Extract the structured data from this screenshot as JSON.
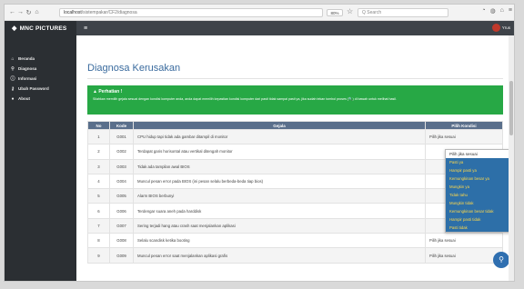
{
  "browser": {
    "url_host": "localhost",
    "url_path": "/sistempakar/CF2/diagnosa",
    "zoom": "80%",
    "search_placeholder": "Q Search"
  },
  "app": {
    "brand": "MNC PICTURES",
    "user_name": "Yrus"
  },
  "sidebar": {
    "items": [
      {
        "label": "Beranda",
        "icon": "home-icon"
      },
      {
        "label": "Diagnosa",
        "icon": "search-icon"
      },
      {
        "label": "Informasi",
        "icon": "info-icon"
      },
      {
        "label": "Ubah Password",
        "icon": "key-icon"
      },
      {
        "label": "About",
        "icon": "info-circle-icon"
      }
    ]
  },
  "page": {
    "title": "Diagnosa Kerusakan"
  },
  "alert": {
    "title": "Perhatian !",
    "text": "Silahkan memilih gejala sesuai dengan kondisi komputer anda, anda dapat memilih kepastian kondisi komputer dari pasti tidak sampai pasti ya, jika sudah tekan tombol proses (🔍) di bawah untuk melihat hasil."
  },
  "table": {
    "headers": [
      "No",
      "Kode",
      "Gejala",
      "Pilih Kondisi"
    ],
    "rows": [
      {
        "no": "1",
        "kode": "G001",
        "gejala": "CPU hidup tapi tidak ada gambar ditampil di monitor",
        "pilih": "Pilih jika sesuai"
      },
      {
        "no": "2",
        "kode": "G002",
        "gejala": "Terdapat garis horisontal atau vertikal ditengah monitor",
        "pilih": ""
      },
      {
        "no": "3",
        "kode": "G003",
        "gejala": "Tidak ada tampilan awal BIOS",
        "pilih": ""
      },
      {
        "no": "4",
        "kode": "G004",
        "gejala": "Muncul pesan error pada BIOS (ini pesan selalu berbeda-beda tiap bios)",
        "pilih": ""
      },
      {
        "no": "5",
        "kode": "G005",
        "gejala": "Alarm BIOS berbunyi",
        "pilih": ""
      },
      {
        "no": "6",
        "kode": "G006",
        "gejala": "Terdengar suara aneh pada harddisk",
        "pilih": ""
      },
      {
        "no": "7",
        "kode": "G007",
        "gejala": "Sering terjadi hang atau crash saat menjalankan aplikasi",
        "pilih": ""
      },
      {
        "no": "8",
        "kode": "G008",
        "gejala": "Selalu scandisk ketika booting",
        "pilih": "Pilih jika sesuai"
      },
      {
        "no": "9",
        "kode": "G009",
        "gejala": "Muncul pesan error saat menjalankan aplikasi grafis",
        "pilih": "Pilih jika sesuai"
      }
    ]
  },
  "dropdown": {
    "selected": "Pilih jika sesuai",
    "options": [
      "Pasti ya",
      "Hampir pasti ya",
      "Kemungkinan besar ya",
      "Mungkin ya",
      "Tidak tahu",
      "Mungkin tidak",
      "Kemungkinan besar tidak",
      "Hampir pasti tidak",
      "Pasti tidak"
    ]
  },
  "colors": {
    "alert": "#27a845",
    "table_header": "#5a6f8b",
    "dropdown_bg": "#2d6fa8",
    "dropdown_text": "#ffd84a",
    "sidebar": "#2b2f33"
  },
  "fab_icon": "search-icon"
}
